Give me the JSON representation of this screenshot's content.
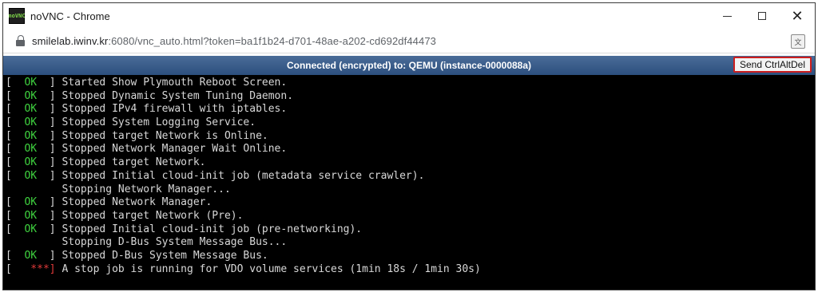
{
  "window": {
    "title": "noVNC - Chrome",
    "icon_text": "noVNC",
    "controls": {
      "minimize": "—",
      "maximize": "☐",
      "close": "✕"
    }
  },
  "address_bar": {
    "host": "smilelab.iwinv.kr",
    "rest": ":6080/vnc_auto.html?token=ba1f1b24-d701-48ae-a202-cd692df44473",
    "translate_icon": "translate-icon"
  },
  "vnc": {
    "status": "Connected (encrypted) to: QEMU (instance-0000088a)",
    "ctrl_alt_del_label": "Send CtrlAltDel",
    "accent_color": "#cc1f1f",
    "bar_color": "#2c4f7e"
  },
  "console": {
    "lines": [
      {
        "prefix_open": "[ ",
        "status": " OK ",
        "prefix_close": " ] ",
        "text": "Started Show Plymouth Reboot Screen."
      },
      {
        "prefix_open": "[ ",
        "status": " OK ",
        "prefix_close": " ] ",
        "text": "Stopped Dynamic System Tuning Daemon."
      },
      {
        "prefix_open": "[ ",
        "status": " OK ",
        "prefix_close": " ] ",
        "text": "Stopped IPv4 firewall with iptables."
      },
      {
        "prefix_open": "[ ",
        "status": " OK ",
        "prefix_close": " ] ",
        "text": "Stopped System Logging Service."
      },
      {
        "prefix_open": "[ ",
        "status": " OK ",
        "prefix_close": " ] ",
        "text": "Stopped target Network is Online."
      },
      {
        "prefix_open": "[ ",
        "status": " OK ",
        "prefix_close": " ] ",
        "text": "Stopped Network Manager Wait Online."
      },
      {
        "prefix_open": "[ ",
        "status": " OK ",
        "prefix_close": " ] ",
        "text": "Stopped target Network."
      },
      {
        "prefix_open": "[ ",
        "status": " OK ",
        "prefix_close": " ] ",
        "text": "Stopped Initial cloud-init job (metadata service crawler)."
      },
      {
        "prefix_open": "         ",
        "status": "",
        "prefix_close": "",
        "text": "Stopping Network Manager..."
      },
      {
        "prefix_open": "[ ",
        "status": " OK ",
        "prefix_close": " ] ",
        "text": "Stopped Network Manager."
      },
      {
        "prefix_open": "[ ",
        "status": " OK ",
        "prefix_close": " ] ",
        "text": "Stopped target Network (Pre)."
      },
      {
        "prefix_open": "[ ",
        "status": " OK ",
        "prefix_close": " ] ",
        "text": "Stopped Initial cloud-init job (pre-networking)."
      },
      {
        "prefix_open": "         ",
        "status": "",
        "prefix_close": "",
        "text": "Stopping D-Bus System Message Bus..."
      },
      {
        "prefix_open": "[ ",
        "status": " OK ",
        "prefix_close": " ] ",
        "text": "Stopped D-Bus System Message Bus."
      },
      {
        "prefix_open": "[ ",
        "status": "  **",
        "status_type": "fail",
        "prefix_close": "*] ",
        "text": "A stop job is running for VDO volume services (1min 18s / 1min 30s)"
      }
    ]
  }
}
